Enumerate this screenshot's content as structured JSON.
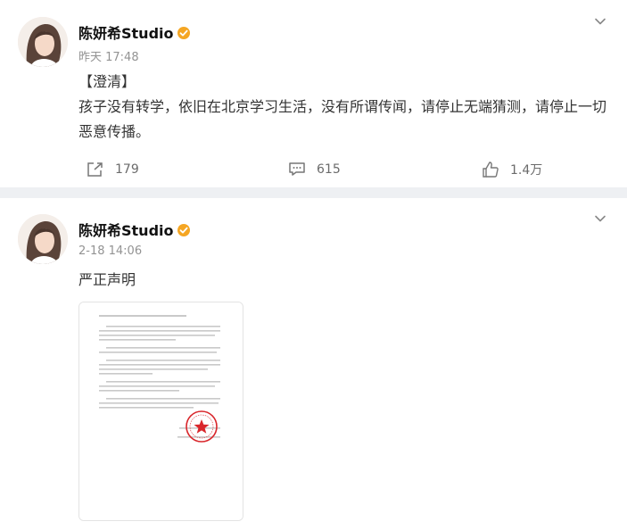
{
  "posts": [
    {
      "username": "陈妍希Studio",
      "timestamp": "昨天 17:48",
      "tag": "【澄清】",
      "body": "孩子没有转学，依旧在北京学习生活，没有所谓传闻，请停止无端猜测，请停止一切恶意传播。",
      "reposts": "179",
      "comments": "615",
      "likes": "1.4万"
    },
    {
      "username": "陈妍希Studio",
      "timestamp": "2-18 14:06",
      "body": "严正声明"
    }
  ],
  "icons": {
    "more": "chevron-down-icon",
    "verified": "verified-badge-icon",
    "repost": "repost-icon",
    "comment": "comment-icon",
    "like": "like-icon"
  },
  "colors": {
    "background": "#eef0f3",
    "card": "#ffffff",
    "meta_text": "#939393",
    "badge": "#f5a623",
    "seal": "#d9262b"
  }
}
